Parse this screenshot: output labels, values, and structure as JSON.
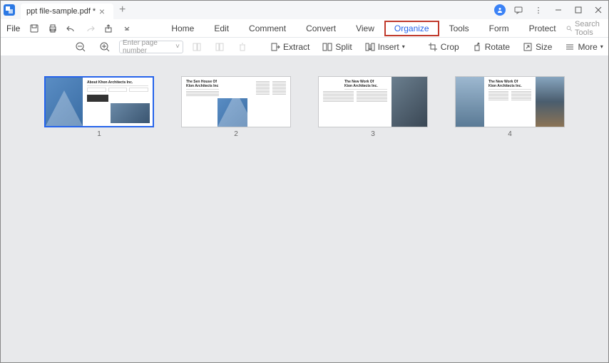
{
  "tab": {
    "title": "ppt file-sample.pdf *"
  },
  "file_menu": "File",
  "main_menu": {
    "home": "Home",
    "edit": "Edit",
    "comment": "Comment",
    "convert": "Convert",
    "view": "View",
    "organize": "Organize",
    "tools": "Tools",
    "form": "Form",
    "protect": "Protect"
  },
  "search": {
    "placeholder": "Search Tools"
  },
  "toolbar": {
    "page_placeholder": "Enter page number",
    "extract": "Extract",
    "split": "Split",
    "insert": "Insert",
    "crop": "Crop",
    "rotate": "Rotate",
    "size": "Size",
    "more": "More"
  },
  "pages": [
    {
      "num": "1",
      "title": "About Khon Architects Inc.",
      "selected": true,
      "layout": "a"
    },
    {
      "num": "2",
      "title": "The Sen House Of\nKlon Architects Inc",
      "selected": false,
      "layout": "b"
    },
    {
      "num": "3",
      "title": "The New Work Of\nKion Architects Inc.",
      "selected": false,
      "layout": "c"
    },
    {
      "num": "4",
      "title": "The New Work Of\nKion Architects Inc.",
      "selected": false,
      "layout": "c2"
    }
  ]
}
